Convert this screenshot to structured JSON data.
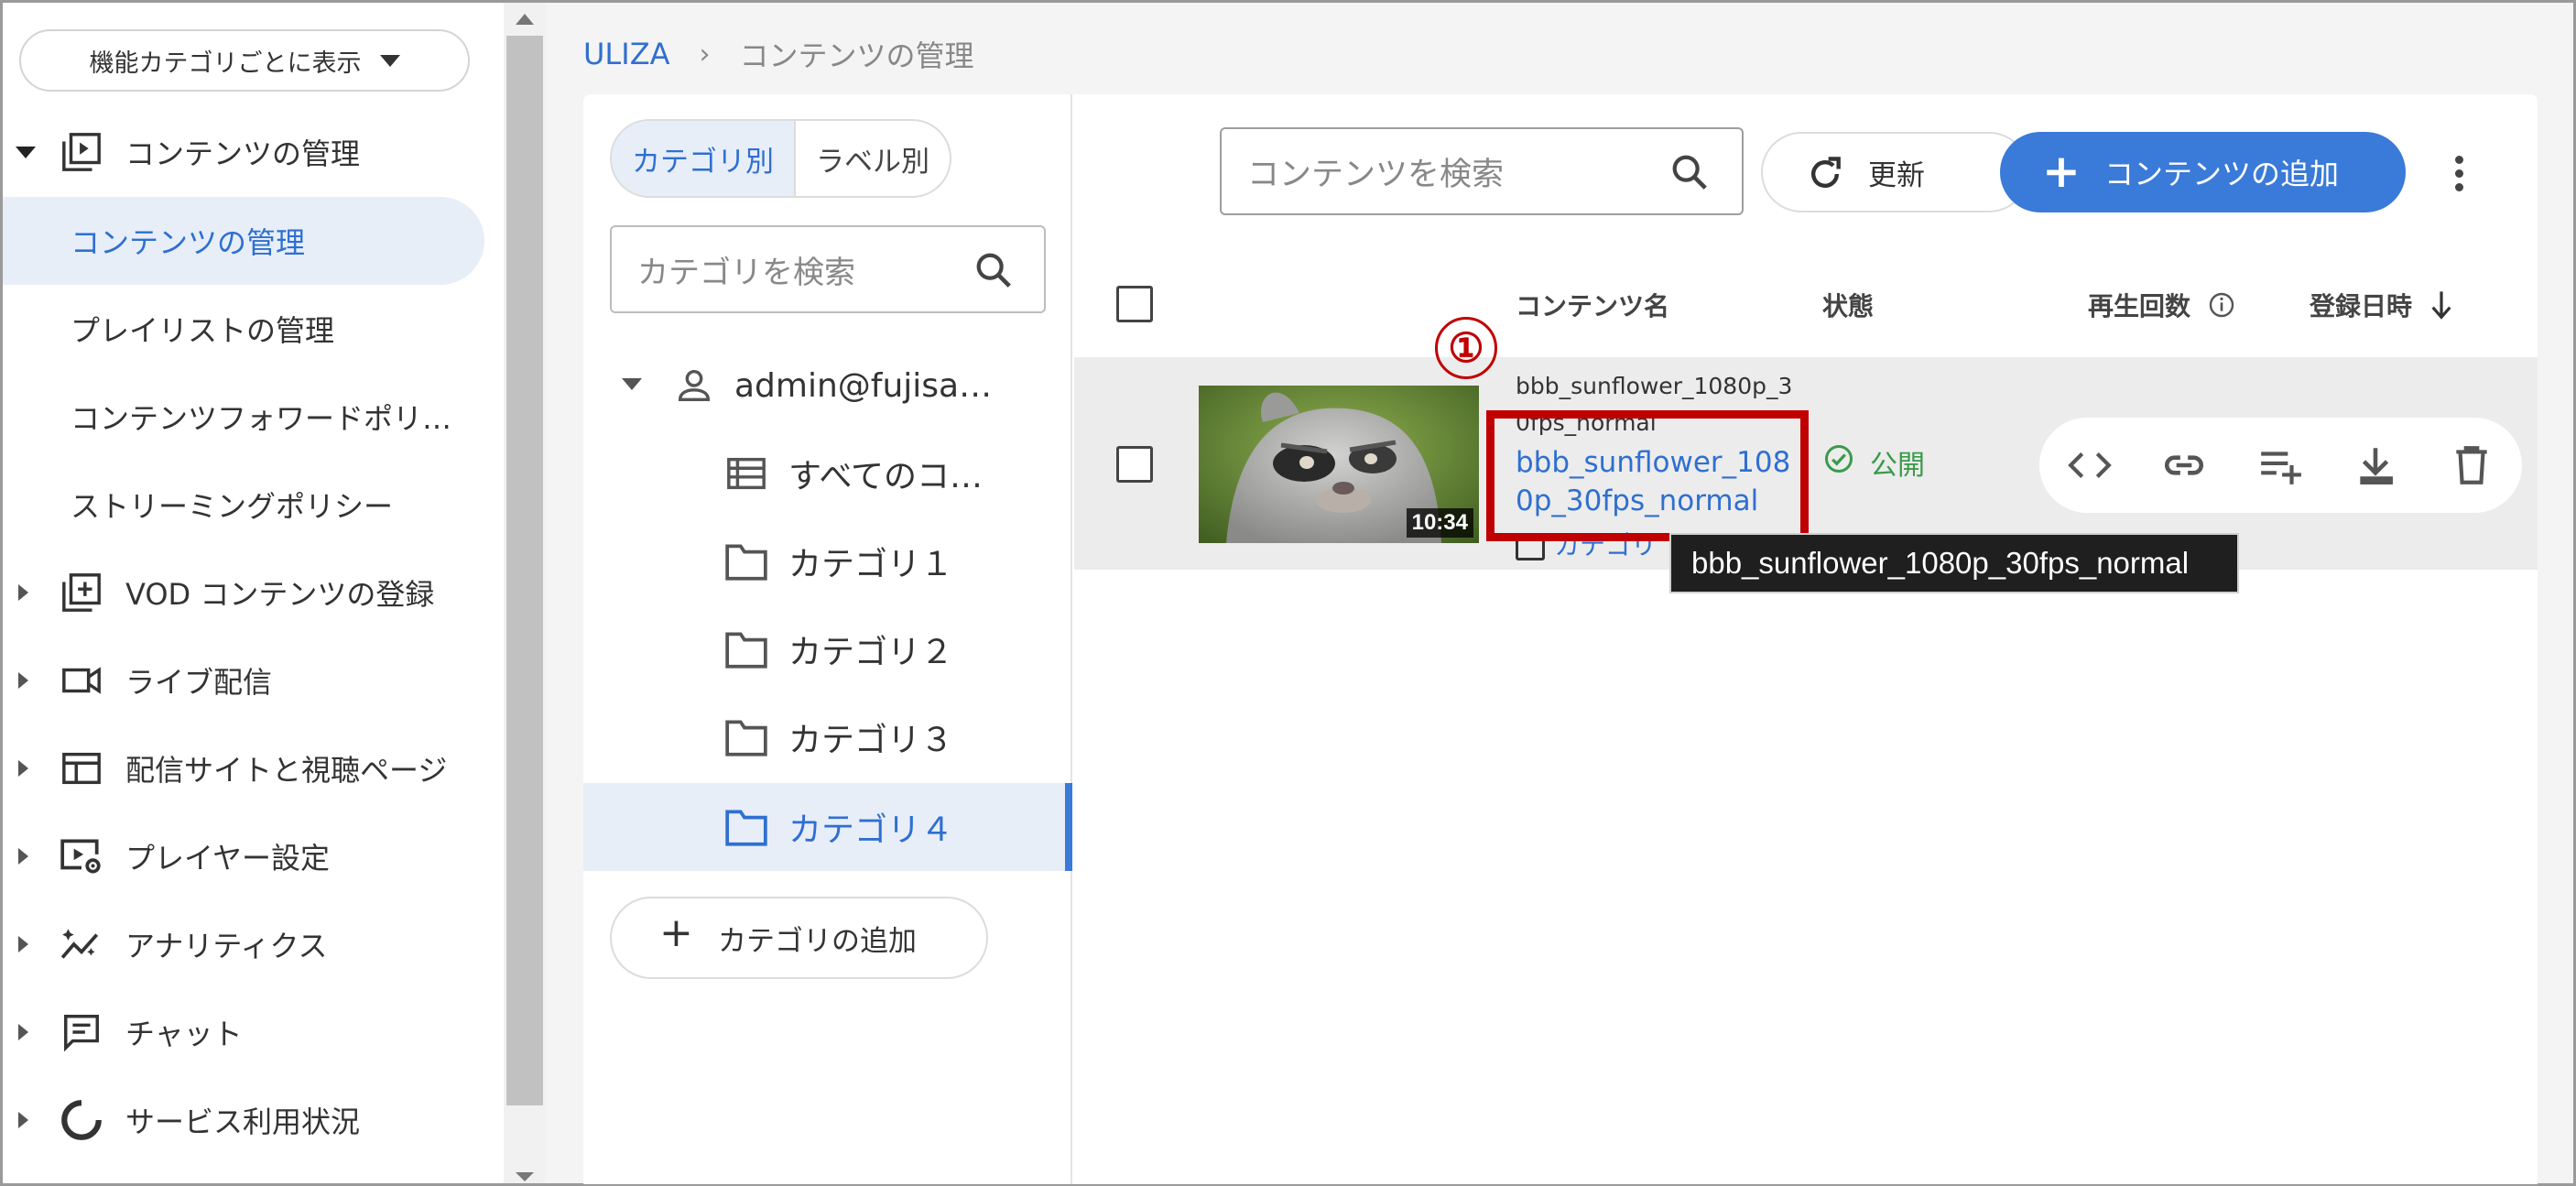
{
  "sidebar": {
    "view_select": "機能カテゴリごとに表示",
    "items": [
      {
        "label": "コンテンツの管理",
        "expanded": true,
        "children": [
          {
            "label": "コンテンツの管理",
            "active": true
          },
          {
            "label": "プレイリストの管理"
          },
          {
            "label": "コンテンツフォワードポリ…"
          },
          {
            "label": "ストリーミングポリシー"
          }
        ]
      },
      {
        "label": "VOD コンテンツの登録"
      },
      {
        "label": "ライブ配信"
      },
      {
        "label": "配信サイトと視聴ページ"
      },
      {
        "label": "プレイヤー設定"
      },
      {
        "label": "アナリティクス"
      },
      {
        "label": "チャット"
      },
      {
        "label": "サービス利用状況"
      }
    ]
  },
  "breadcrumb": {
    "home": "ULIZA",
    "separator": "›",
    "current": "コンテンツの管理"
  },
  "category_panel": {
    "tabs": [
      {
        "label": "カテゴリ別",
        "active": true
      },
      {
        "label": "ラベル別",
        "active": false
      }
    ],
    "search_placeholder": "カテゴリを検索",
    "account": "admin@fujisa…",
    "all_contents": "すべてのコ…",
    "categories": [
      "カテゴリ１",
      "カテゴリ２",
      "カテゴリ３",
      "カテゴリ４"
    ],
    "active_category": "カテゴリ４",
    "add_label": "カテゴリの追加"
  },
  "toolbar": {
    "search_placeholder": "コンテンツを検索",
    "refresh_label": "更新",
    "add_label": "コンテンツの追加"
  },
  "table": {
    "columns": {
      "name": "コンテンツ名",
      "status": "状態",
      "plays": "再生回数",
      "registered": "登録日時"
    },
    "sort": {
      "column": "登録日時",
      "direction": "desc"
    },
    "rows": [
      {
        "duration": "10:34",
        "name_line1": "bbb_sunflower_1080p_3",
        "name_line2": "0fps_normal",
        "link_line1": "bbb_sunflower_108",
        "link_line2": "0p_30fps_normal",
        "category": "カテゴリ",
        "status": "公開",
        "actions": [
          "code-icon",
          "link-icon",
          "playlist-add-icon",
          "download-icon",
          "delete-icon"
        ]
      }
    ]
  },
  "annotation": {
    "step": "①",
    "color": "#c00000"
  },
  "tooltip": "bbb_sunflower_1080p_30fps_normal",
  "colors": {
    "accent": "#3a7ad8",
    "link": "#2f6fd0",
    "status_ok": "#3a9a4a",
    "selected_bg": "#e7eef8"
  }
}
